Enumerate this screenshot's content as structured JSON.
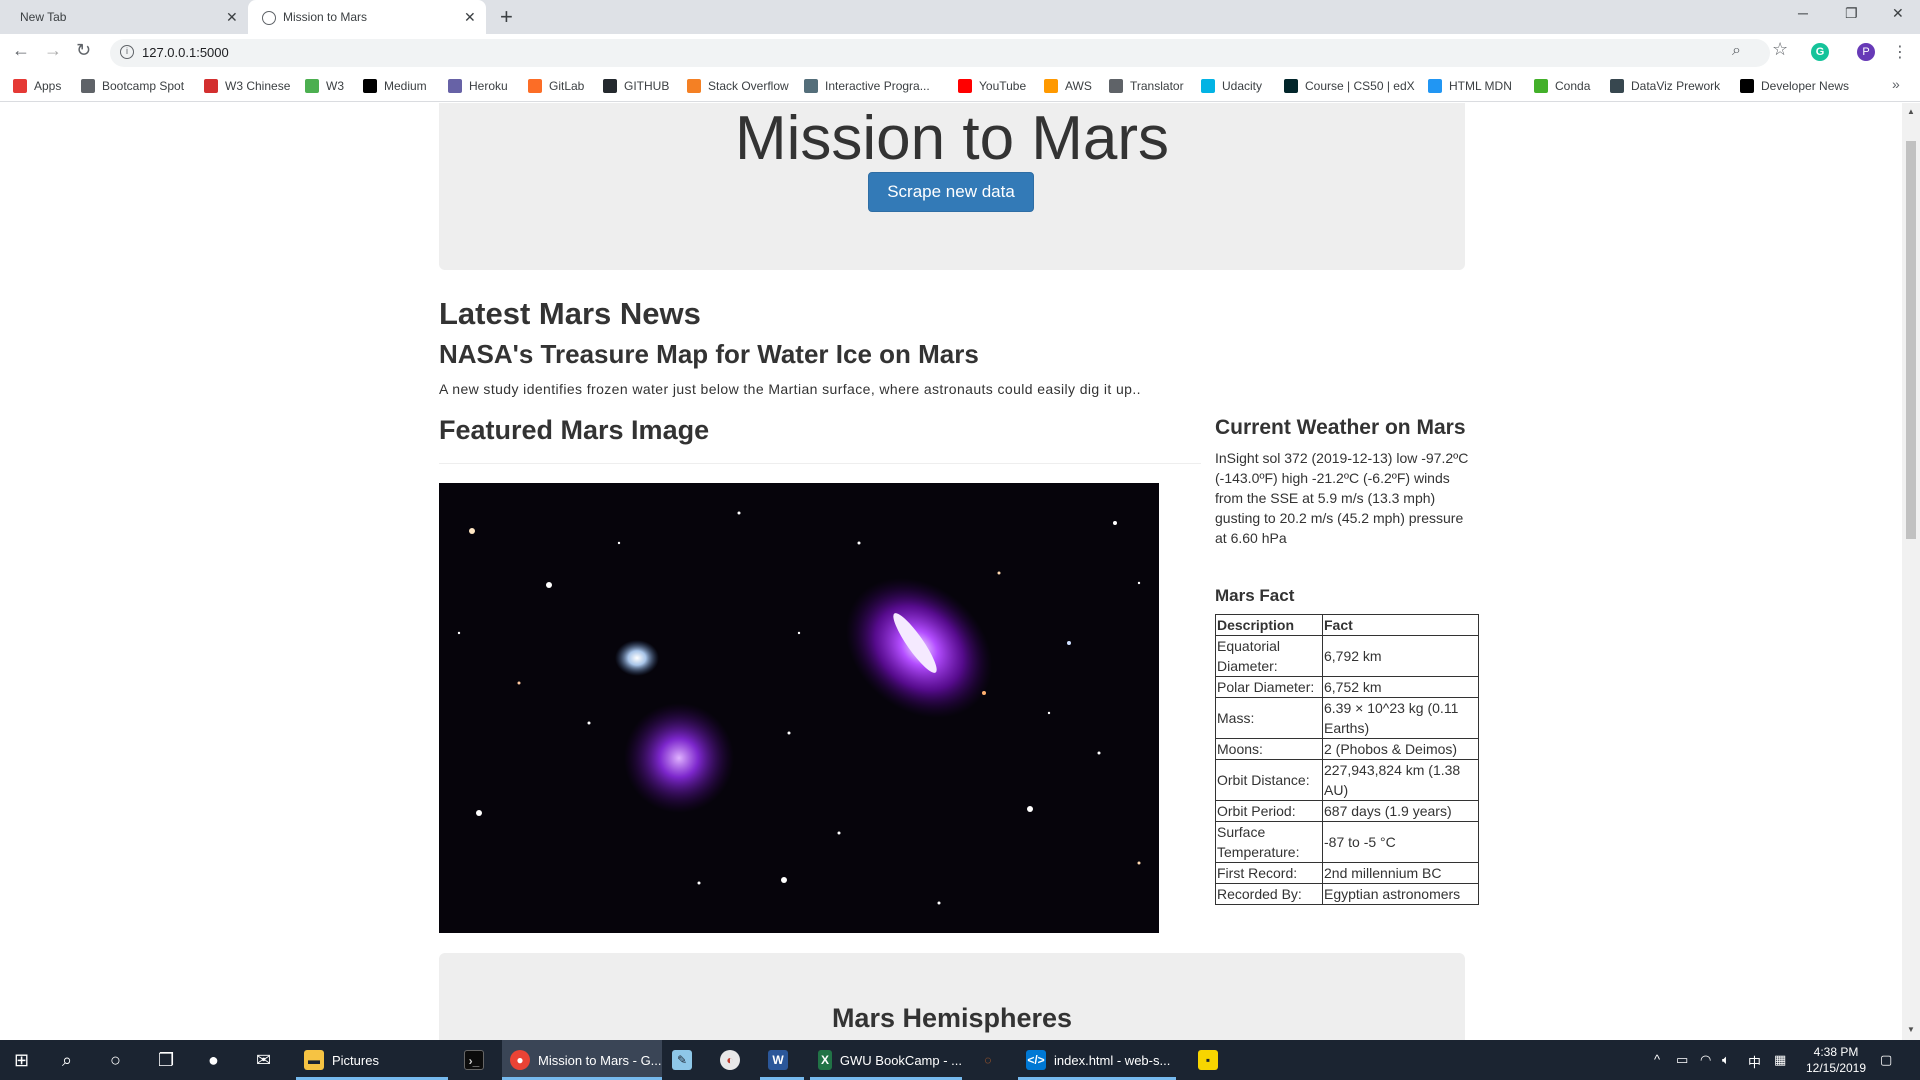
{
  "browser": {
    "tabs": [
      {
        "title": "New Tab"
      },
      {
        "title": "Mission to Mars"
      }
    ],
    "url": "127.0.0.1:5000",
    "profile_initial": "P",
    "bookmarks": [
      {
        "label": "Apps",
        "icon": "apps-grid-icon",
        "color": "#e53935"
      },
      {
        "label": "Bootcamp Spot",
        "icon": "globe-icon",
        "color": "#5f6368"
      },
      {
        "label": "W3 Chinese",
        "icon": "w3-chinese-icon",
        "color": "#d32f2f"
      },
      {
        "label": "W3",
        "icon": "w3schools-icon",
        "color": "#4caf50"
      },
      {
        "label": "Medium",
        "icon": "medium-icon",
        "color": "#000000"
      },
      {
        "label": "Heroku",
        "icon": "heroku-icon",
        "color": "#6762a6"
      },
      {
        "label": "GitLab",
        "icon": "gitlab-icon",
        "color": "#fc6d26"
      },
      {
        "label": "GITHUB",
        "icon": "github-icon",
        "color": "#24292e"
      },
      {
        "label": "Stack Overflow",
        "icon": "stackoverflow-icon",
        "color": "#f48024"
      },
      {
        "label": "Interactive Progra...",
        "icon": "interactive-programming-icon",
        "color": "#546e7a"
      },
      {
        "label": "YouTube",
        "icon": "youtube-icon",
        "color": "#ff0000"
      },
      {
        "label": "AWS",
        "icon": "aws-icon",
        "color": "#ff9900"
      },
      {
        "label": "Translator",
        "icon": "globe-icon",
        "color": "#5f6368"
      },
      {
        "label": "Udacity",
        "icon": "udacity-icon",
        "color": "#02b3e4"
      },
      {
        "label": "Course | CS50 | edX",
        "icon": "edx-icon",
        "color": "#02262b"
      },
      {
        "label": "HTML MDN",
        "icon": "mdn-icon",
        "color": "#2196f3"
      },
      {
        "label": "Conda",
        "icon": "conda-icon",
        "color": "#43b02a"
      },
      {
        "label": "DataViz Prework",
        "icon": "dataviz-icon",
        "color": "#37474f"
      },
      {
        "label": "Developer News",
        "icon": "developer-news-icon",
        "color": "#000000"
      }
    ]
  },
  "page": {
    "title": "Mission to Mars",
    "scrape_button": "Scrape new data",
    "news": {
      "heading": "Latest Mars News",
      "title": "NASA's Treasure Map for Water Ice on Mars",
      "teaser": "A new study identifies frozen water just below the Martian surface, where astronauts could easily dig it up.."
    },
    "featured_image": {
      "heading": "Featured Mars Image"
    },
    "weather": {
      "heading": "Current Weather on Mars",
      "text": "InSight sol 372 (2019-12-13) low -97.2ºC (-143.0ºF) high -21.2ºC (-6.2ºF) winds from the SSE at 5.9 m/s (13.3 mph) gusting to 20.2 m/s (45.2 mph) pressure at 6.60 hPa"
    },
    "facts": {
      "heading": "Mars Fact",
      "columns": [
        "Description",
        "Fact"
      ],
      "rows": [
        [
          "Equatorial Diameter:",
          "6,792 km"
        ],
        [
          "Polar Diameter:",
          "6,752 km"
        ],
        [
          "Mass:",
          "6.39 × 10^23 kg (0.11 Earths)"
        ],
        [
          "Moons:",
          "2 (Phobos & Deimos)"
        ],
        [
          "Orbit Distance:",
          "227,943,824 km (1.38 AU)"
        ],
        [
          "Orbit Period:",
          "687 days (1.9 years)"
        ],
        [
          "Surface Temperature:",
          "-87 to -5 °C"
        ],
        [
          "First Record:",
          "2nd millennium BC"
        ],
        [
          "Recorded By:",
          "Egyptian astronomers"
        ]
      ]
    },
    "hemispheres": {
      "heading": "Mars Hemispheres"
    }
  },
  "taskbar": {
    "apps": [
      {
        "label": "Pictures",
        "icon": "file-explorer-icon",
        "color": "#f6c343"
      },
      {
        "label": "",
        "icon": "terminal-icon",
        "color": "#0c0c0c"
      },
      {
        "label": "Mission to Mars - G...",
        "icon": "chrome-icon",
        "color": "#ea4335"
      },
      {
        "label": "",
        "icon": "notepad-icon",
        "color": "#8ec7e8"
      },
      {
        "label": "",
        "icon": "paint-icon",
        "color": "#e8e8e8"
      },
      {
        "label": "",
        "icon": "word-icon",
        "color": "#2b579a"
      },
      {
        "label": "GWU BookCamp - ...",
        "icon": "excel-icon",
        "color": "#217346"
      },
      {
        "label": "",
        "icon": "jupyter-icon",
        "color": "#f37626"
      },
      {
        "label": "index.html - web-s...",
        "icon": "vscode-icon",
        "color": "#0078d4"
      },
      {
        "label": "",
        "icon": "sticky-notes-icon",
        "color": "#f7d500"
      }
    ],
    "ime": "中",
    "time": "4:38 PM",
    "date": "12/15/2019"
  },
  "colors": {
    "button_primary": "#337ab7",
    "jumbotron_bg": "#eeeeee",
    "taskbar_bg": "#1b2431"
  }
}
